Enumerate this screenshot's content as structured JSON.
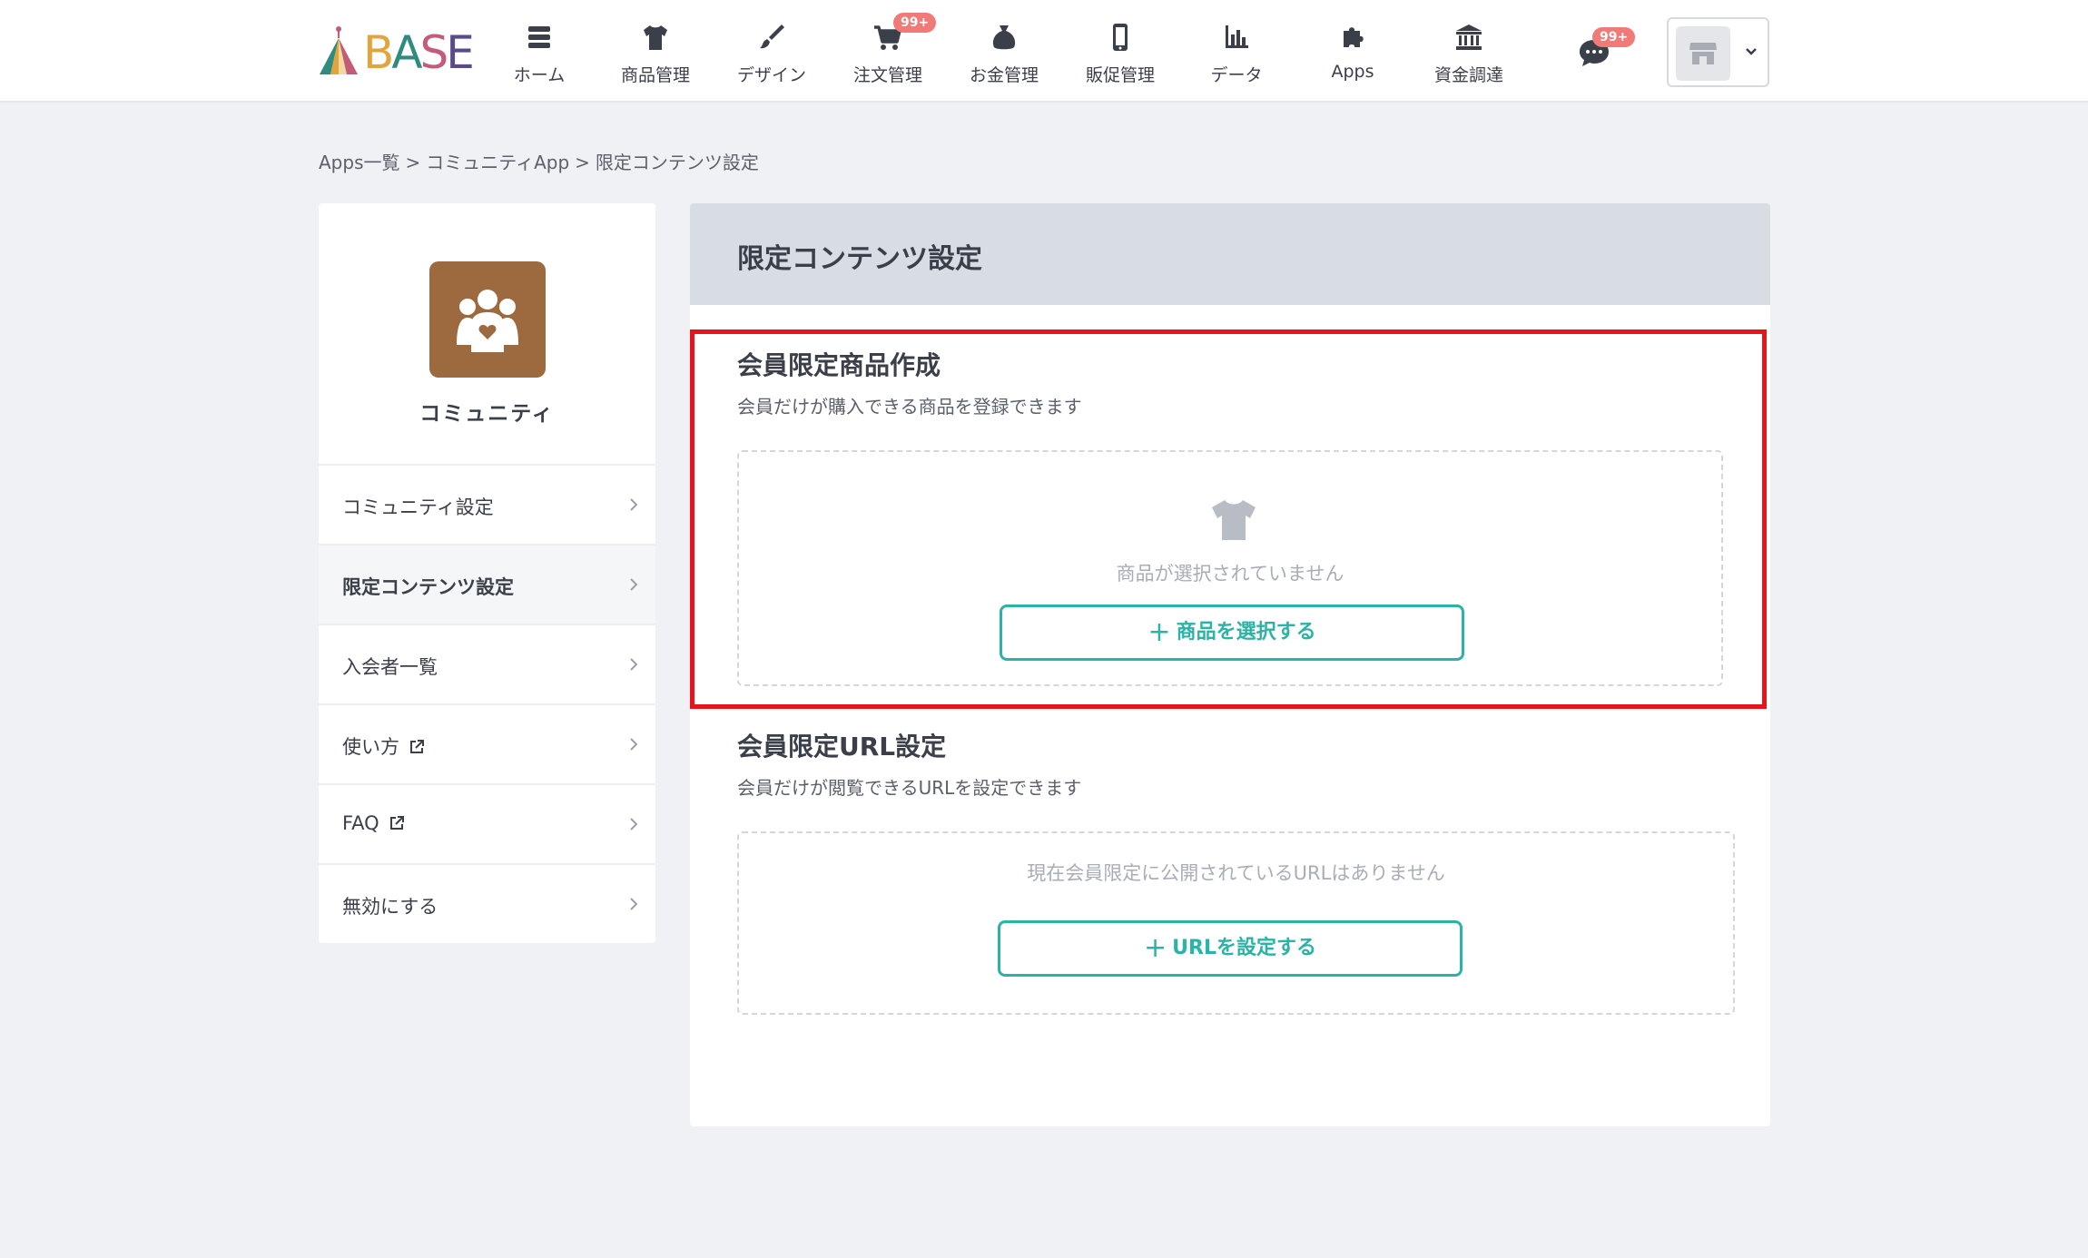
{
  "logo": {
    "letters": [
      "B",
      "A",
      "S",
      "E"
    ]
  },
  "nav": [
    {
      "label": "ホーム",
      "icon": "list-icon"
    },
    {
      "label": "商品管理",
      "icon": "tshirt-icon"
    },
    {
      "label": "デザイン",
      "icon": "brush-icon"
    },
    {
      "label": "注文管理",
      "icon": "cart-icon",
      "badge": "99+"
    },
    {
      "label": "お金管理",
      "icon": "money-bag-icon"
    },
    {
      "label": "販促管理",
      "icon": "phone-icon"
    },
    {
      "label": "データ",
      "icon": "bar-chart-icon"
    },
    {
      "label": "Apps",
      "icon": "puzzle-icon"
    },
    {
      "label": "資金調達",
      "icon": "bank-icon"
    }
  ],
  "messages": {
    "badge": "99+",
    "icon": "chat-icon"
  },
  "shop": {
    "icon": "store-icon"
  },
  "breadcrumb": {
    "items": [
      "Apps一覧",
      "コミュニティApp",
      "限定コンテンツ設定"
    ],
    "separator": ">"
  },
  "sidebar": {
    "app_name": "コミュニティ",
    "app_icon": "community-icon",
    "items": [
      {
        "label": "コミュニティ設定"
      },
      {
        "label": "限定コンテンツ設定"
      },
      {
        "label": "入会者一覧"
      },
      {
        "label": "使い方",
        "external": true
      },
      {
        "label": "FAQ",
        "external": true
      },
      {
        "label": "無効にする"
      }
    ]
  },
  "main": {
    "title": "限定コンテンツ設定",
    "product_section": {
      "title": "会員限定商品作成",
      "description": "会員だけが購入できる商品を登録できます",
      "empty_text": "商品が選択されていません",
      "button_label": "商品を選択する",
      "button_prefix": "+"
    },
    "url_section": {
      "title": "会員限定URL設定",
      "description": "会員だけが閲覧できるURLを設定できます",
      "empty_text": "現在会員限定に公開されているURLはありません",
      "button_label": "URLを設定する",
      "button_prefix": "+"
    }
  },
  "colors": {
    "accent": "#2bb3a5",
    "highlight": "#e8141c",
    "badge": "#f07a78",
    "app_icon_bg": "#9c6a3e"
  }
}
